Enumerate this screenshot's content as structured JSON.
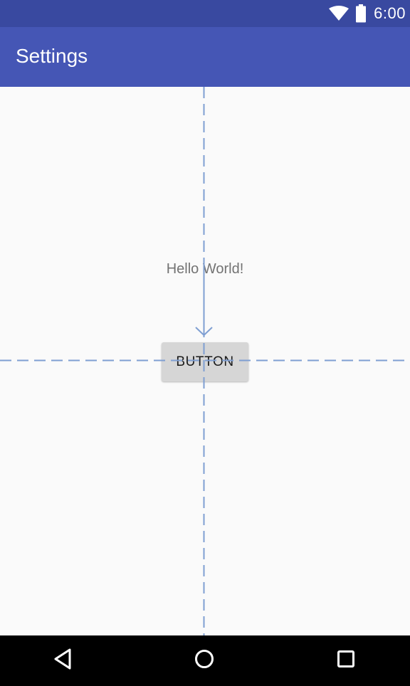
{
  "status_bar": {
    "time": "6:00",
    "icons": [
      "wifi-icon",
      "battery-icon"
    ],
    "background": "#3949a0"
  },
  "app_bar": {
    "title": "Settings",
    "background": "#4556b5"
  },
  "content": {
    "hello_text": "Hello World!",
    "button_label": "BUTTON",
    "guide_color": "#7f9fd2"
  },
  "nav_bar": {
    "icons": [
      "back-icon",
      "home-icon",
      "recents-icon"
    ]
  }
}
